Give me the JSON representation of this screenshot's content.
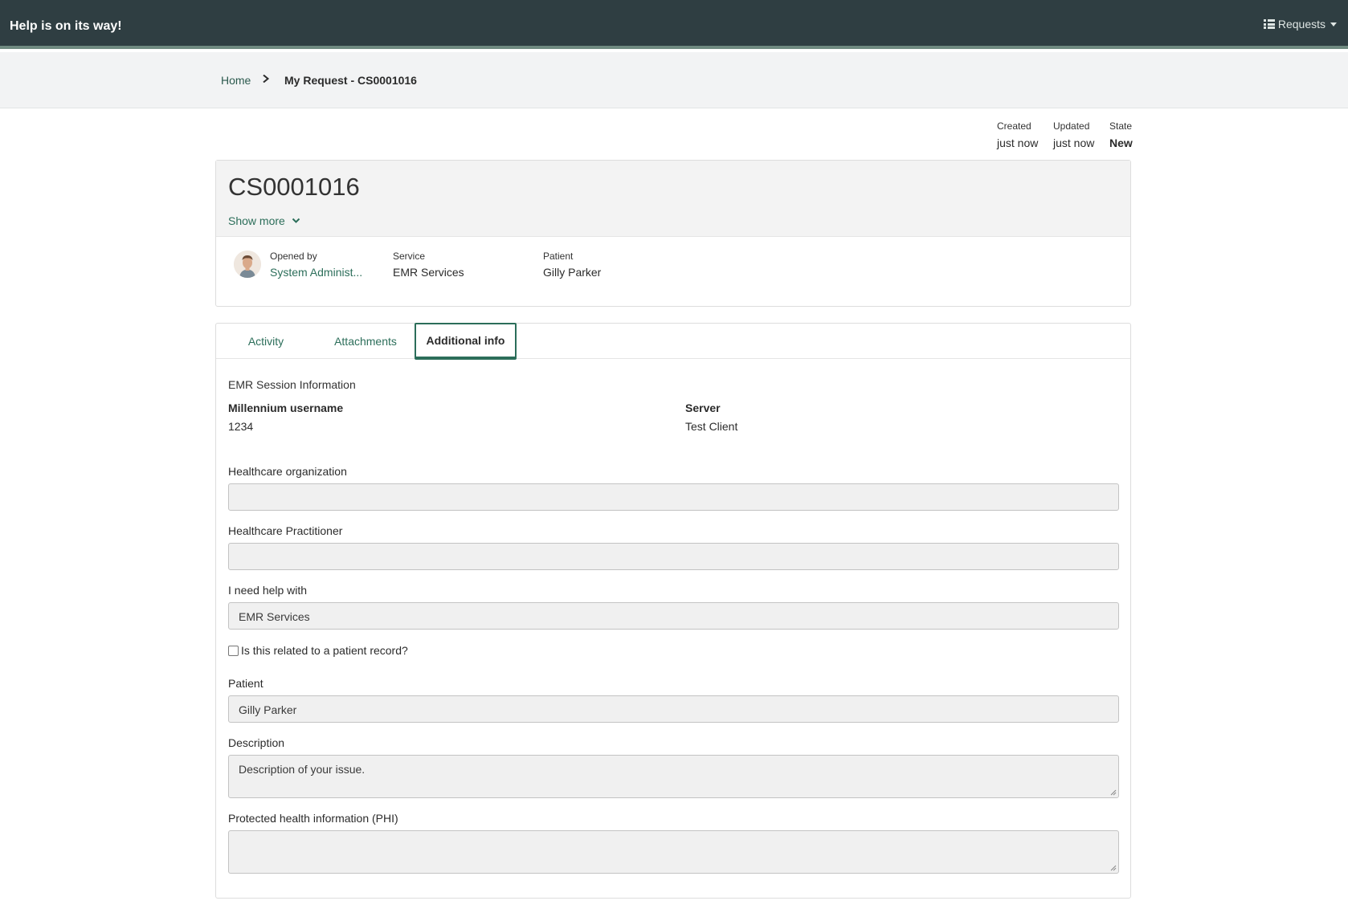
{
  "header": {
    "brand": "Help is on its way!",
    "requests_menu": "Requests"
  },
  "breadcrumb": {
    "home": "Home",
    "current": "My Request - CS0001016"
  },
  "meta": {
    "created_label": "Created",
    "created_value": "just now",
    "updated_label": "Updated",
    "updated_value": "just now",
    "state_label": "State",
    "state_value": "New"
  },
  "case": {
    "number": "CS0001016",
    "show_more": "Show more",
    "opened_by_label": "Opened by",
    "opened_by_value": "System Administ...",
    "service_label": "Service",
    "service_value": "EMR Services",
    "patient_label": "Patient",
    "patient_value": "Gilly Parker"
  },
  "tabs": [
    {
      "label": "Activity"
    },
    {
      "label": "Attachments"
    },
    {
      "label": "Additional info",
      "active": true
    }
  ],
  "additional_info": {
    "section_title": "EMR Session Information",
    "millennium_username_label": "Millennium username",
    "millennium_username_value": "1234",
    "server_label": "Server",
    "server_value": "Test Client",
    "healthcare_org_label": "Healthcare organization",
    "healthcare_org_value": "",
    "practitioner_label": "Healthcare Practitioner",
    "practitioner_value": "",
    "need_help_label": "I need help with",
    "need_help_value": "EMR Services",
    "patient_record_checkbox_label": "Is this related to a patient record?",
    "patient_record_checked": false,
    "patient_label": "Patient",
    "patient_value": "Gilly Parker",
    "description_label": "Description",
    "description_value": "Description of your issue.",
    "phi_label": "Protected health information (PHI)",
    "phi_value": ""
  },
  "icons": {
    "requests_menu_icon": "list-icon",
    "breadcrumb_separator": "chevron-right-icon",
    "show_more_icon": "chevron-down-icon",
    "avatar": "user-avatar"
  },
  "colors": {
    "navbar": "#2f3e42",
    "accent": "#2c6e5a",
    "input_bg": "#f0f0f0"
  }
}
